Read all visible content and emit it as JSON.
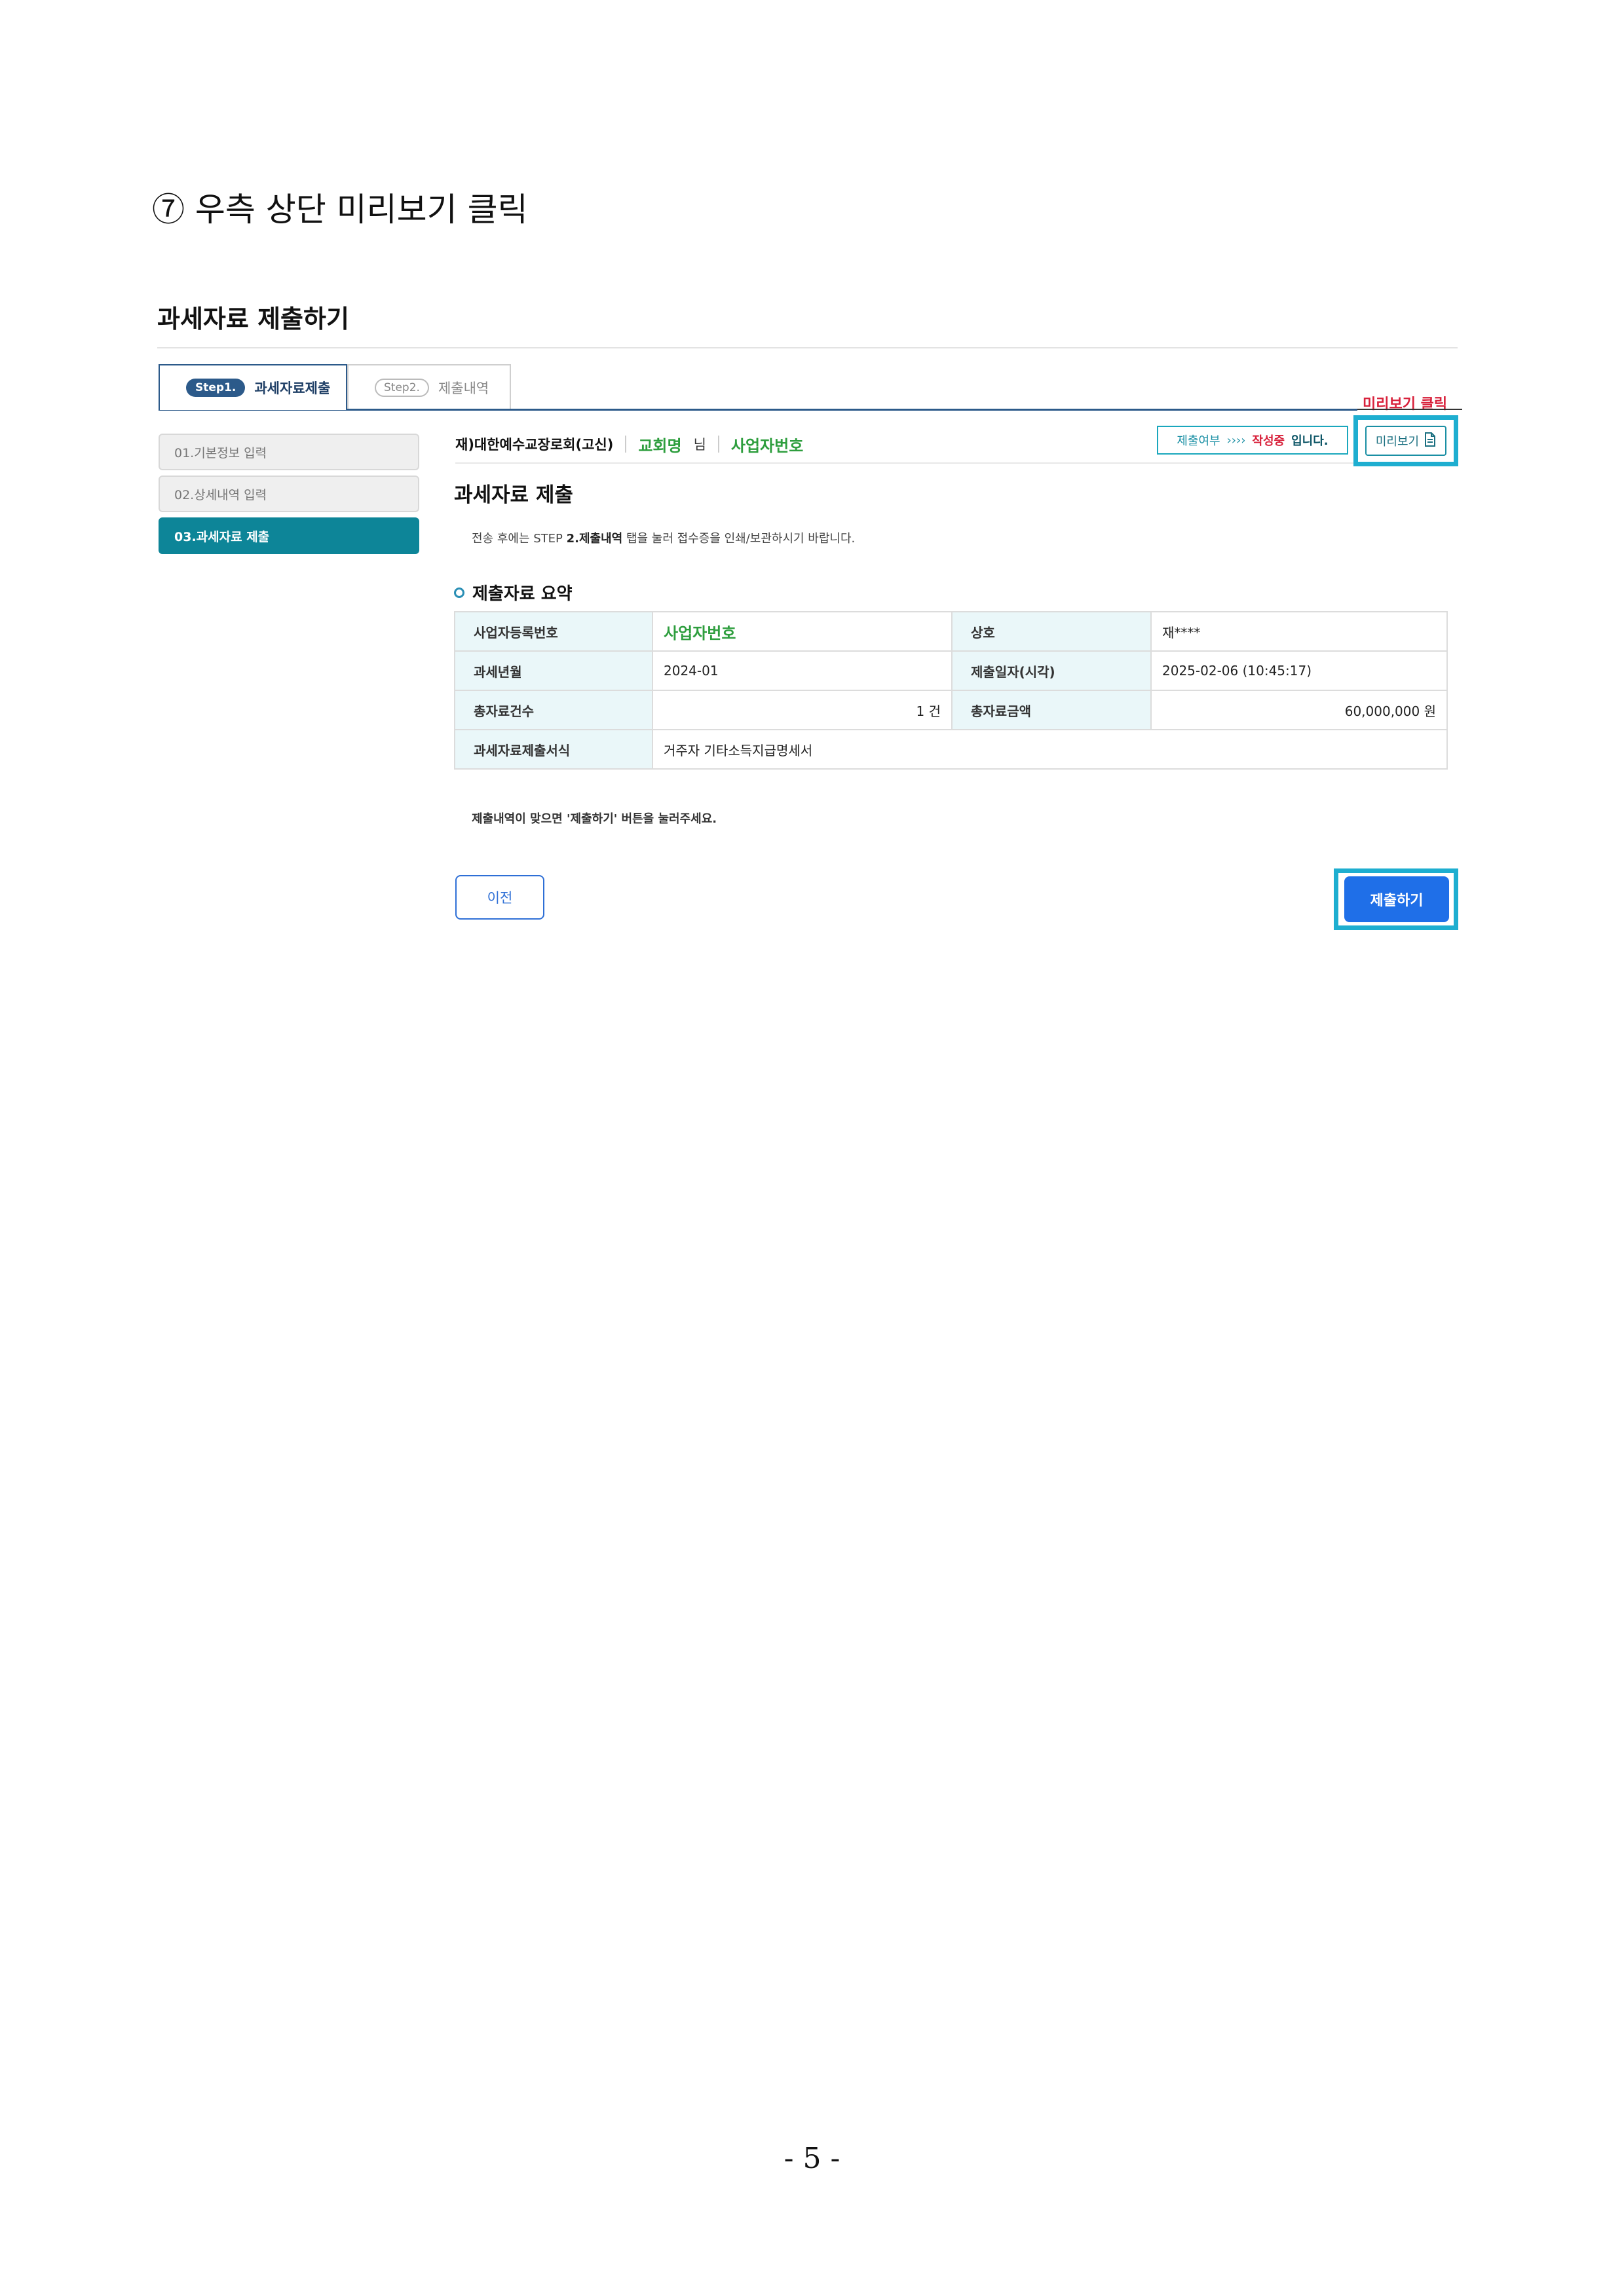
{
  "document": {
    "heading": "⑦ 우측 상단 미리보기 클릭",
    "page_number": "- 5 -"
  },
  "section_title": "과세자료 제출하기",
  "tabs": [
    {
      "step": "Step1.",
      "label": "과세자료제출"
    },
    {
      "step": "Step2.",
      "label": "제출내역"
    }
  ],
  "callout": "미리보기 클릭",
  "sidebar": {
    "items": [
      {
        "label": "01.기본정보 입력"
      },
      {
        "label": "02.상세내역 입력"
      },
      {
        "label": "03.과세자료 제출"
      }
    ]
  },
  "org": {
    "name": "재)대한예수교장로회(고신)",
    "church": "교회명",
    "honorific": "님",
    "biz_no": "사업자번호"
  },
  "status": {
    "label": "제출여부",
    "arrows": "››››",
    "value": "작성중",
    "suffix": "입니다."
  },
  "preview_button": "미리보기",
  "main": {
    "title": "과세자료 제출",
    "notice_prefix": "전송 후에는 STEP ",
    "notice_bold": "2.제출내역",
    "notice_suffix": " 탭을 눌러 접수증을 인쇄/보관하시기 바랍니다.",
    "summary_title": "제출자료 요약",
    "confirm_note": "제출내역이 맞으면 '제출하기' 버튼을 눌러주세요."
  },
  "summary": {
    "biz_reg_label": "사업자등록번호",
    "biz_reg_value": "사업자번호",
    "company_label": "상호",
    "company_value": "재****",
    "tax_month_label": "과세년월",
    "tax_month_value": "2024-01",
    "submit_date_label": "제출일자(시각)",
    "submit_date_value": "2025-02-06 (10:45:17)",
    "total_count_label": "총자료건수",
    "total_count_value": "1 건",
    "total_amount_label": "총자료금액",
    "total_amount_value": "60,000,000 원",
    "form_label": "과세자료제출서식",
    "form_value": "거주자 기타소득지급명세서"
  },
  "buttons": {
    "prev": "이전",
    "submit": "제출하기"
  },
  "colors": {
    "accent_teal": "#0d8598",
    "highlight_cyan": "#1eaed0",
    "submit_blue": "#1f6fe8",
    "green": "#2e9e3e",
    "red": "#d8213b"
  }
}
